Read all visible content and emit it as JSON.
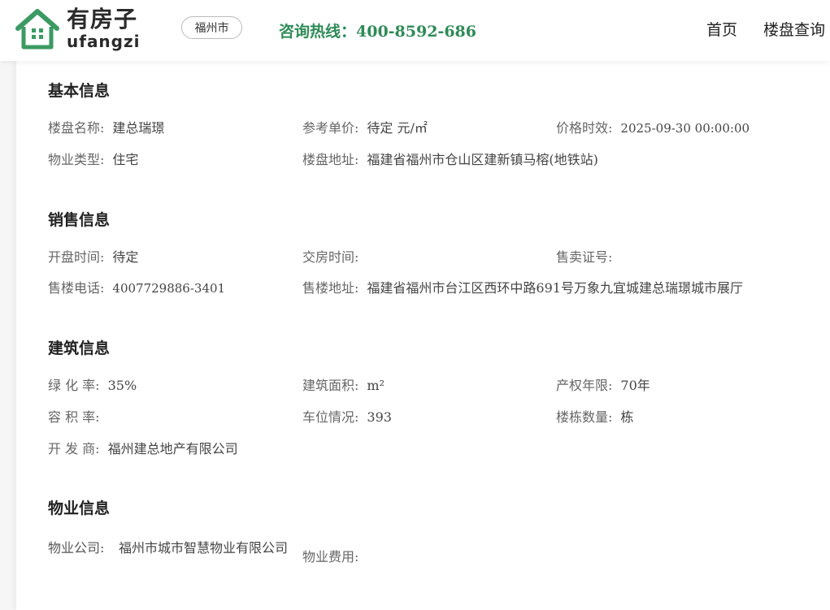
{
  "header": {
    "logo_cn": "有房子",
    "logo_en": "ufangzi",
    "city": "福州市",
    "hotline": "咨询热线：400-8592-686",
    "nav": [
      "首页",
      "楼盘查询"
    ],
    "brand_color": "#2e8b57"
  },
  "basic": {
    "title": "基本信息",
    "name_label": "楼盘名称:",
    "name_value": "建总瑞璟",
    "price_label": "参考单价:",
    "price_value": "待定 元/㎡",
    "price_time_label": "价格时效:",
    "price_time_value": "2025-09-30 00:00:00",
    "type_label": "物业类型:",
    "type_value": "住宅",
    "address_label": "楼盘地址:",
    "address_value": "福建省福州市仓山区建新镇马榕(地铁站)"
  },
  "sales": {
    "title": "销售信息",
    "open_label": "开盘时间:",
    "open_value": "待定",
    "delivery_label": "交房时间:",
    "delivery_value": "",
    "license_label": "售卖证号:",
    "license_value": "",
    "phone_label": "售楼电话:",
    "phone_value": "4007729886-3401",
    "sales_addr_label": "售楼地址:",
    "sales_addr_value": "福建省福州市台江区西环中路691号万象九宜城建总瑞璟城市展厅"
  },
  "building": {
    "title": "建筑信息",
    "green_label": "绿 化 率:",
    "green_value": "35%",
    "area_label": "建筑面积:",
    "area_value": "m²",
    "term_label": "产权年限:",
    "term_value": "70年",
    "far_label": "容 积 率:",
    "far_value": "",
    "parking_label": "车位情况:",
    "parking_value": "393",
    "count_label": "楼栋数量:",
    "count_value": "栋",
    "dev_label": "开 发 商:",
    "dev_value": "福州建总地产有限公司"
  },
  "property": {
    "title": "物业信息",
    "company_label": "物业公司:",
    "company_value": "福州市城市智慧物业有限公司",
    "fee_label": "物业费用:",
    "fee_value": ""
  }
}
